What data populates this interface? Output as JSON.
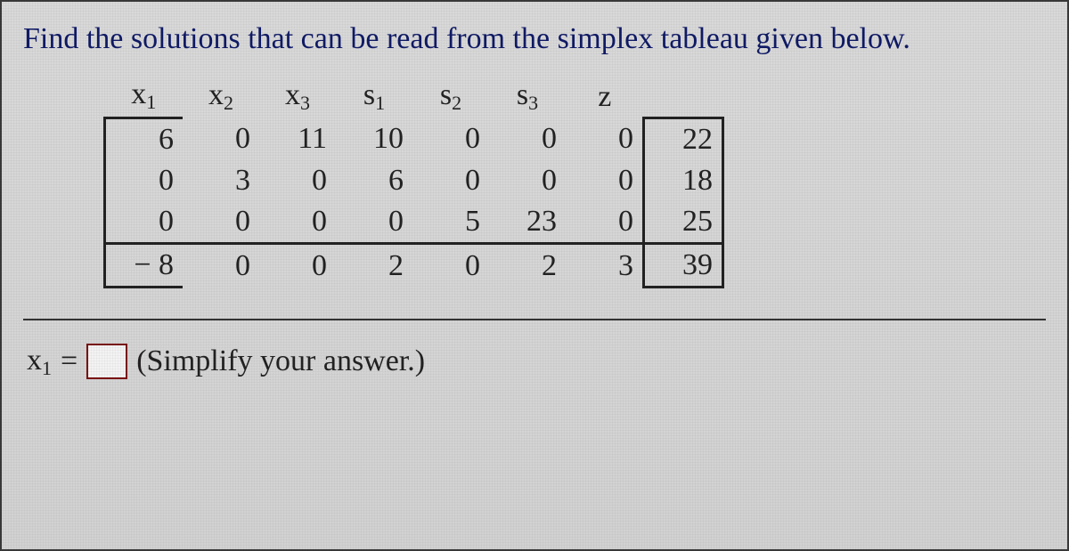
{
  "instruction": "Find the solutions that can be read from the simplex tableau given below.",
  "headers": {
    "x1": "x",
    "x1_sub": "1",
    "x2": "x",
    "x2_sub": "2",
    "x3": "x",
    "x3_sub": "3",
    "s1": "s",
    "s1_sub": "1",
    "s2": "s",
    "s2_sub": "2",
    "s3": "s",
    "s3_sub": "3",
    "z": "z"
  },
  "rows": [
    {
      "x1": "6",
      "x2": "0",
      "x3": "11",
      "s1": "10",
      "s2": "0",
      "s3": "0",
      "z": "0",
      "rhs": "22"
    },
    {
      "x1": "0",
      "x2": "3",
      "x3": "0",
      "s1": "6",
      "s2": "0",
      "s3": "0",
      "z": "0",
      "rhs": "18"
    },
    {
      "x1": "0",
      "x2": "0",
      "x3": "0",
      "s1": "0",
      "s2": "5",
      "s3": "23",
      "z": "0",
      "rhs": "25"
    },
    {
      "x1": "− 8",
      "x2": "0",
      "x3": "0",
      "s1": "2",
      "s2": "0",
      "s3": "2",
      "z": "3",
      "rhs": "39"
    }
  ],
  "answer": {
    "var": "x",
    "var_sub": "1",
    "equals": "=",
    "value": "",
    "hint": "(Simplify your answer.)"
  }
}
